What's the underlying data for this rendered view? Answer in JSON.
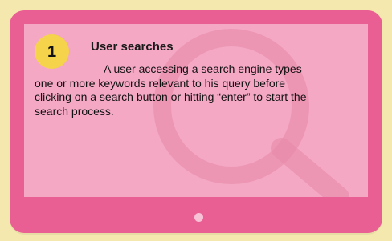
{
  "step": {
    "number": "1",
    "title": "User searches",
    "description": "A user accessing a search engine types one or more keywords relevant to his query before clicking on a search button or hitting “enter” to start the search process."
  },
  "icons": {
    "watermark": "magnifying-glass-icon",
    "device_button": "home-button-icon"
  },
  "colors": {
    "background": "#f5e8ae",
    "device_frame": "#ea5f93",
    "screen": "#f4a8c4",
    "badge": "#f5d34a"
  }
}
